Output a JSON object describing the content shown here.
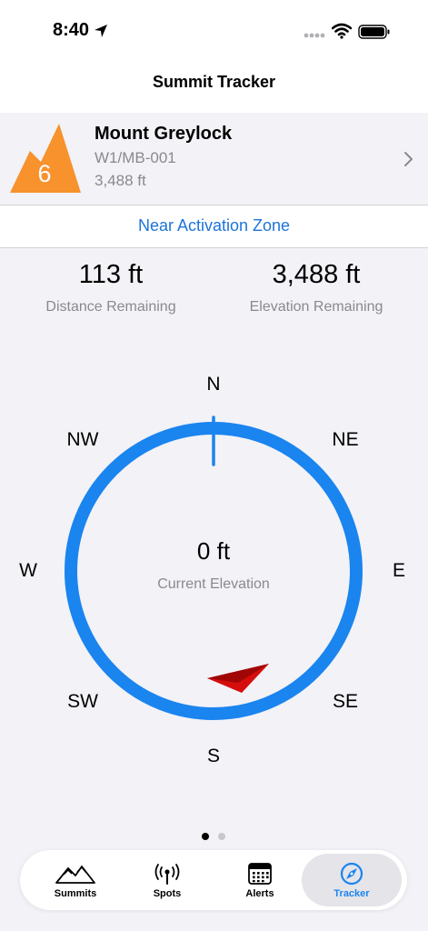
{
  "status_bar": {
    "time": "8:40"
  },
  "nav": {
    "title": "Summit Tracker"
  },
  "summit": {
    "badge_number": "6",
    "name": "Mount Greylock",
    "reference": "W1/MB-001",
    "elevation": "3,488 ft"
  },
  "zone_banner": {
    "text": "Near Activation Zone"
  },
  "stats": {
    "distance_value": "113 ft",
    "distance_label": "Distance Remaining",
    "elevation_value": "3,488 ft",
    "elevation_label": "Elevation Remaining"
  },
  "compass": {
    "n": "N",
    "ne": "NE",
    "e": "E",
    "se": "SE",
    "s": "S",
    "sw": "SW",
    "w": "W",
    "nw": "NW",
    "center_value": "0 ft",
    "center_label": "Current Elevation"
  },
  "tabs": [
    {
      "label": "Summits",
      "icon": "mountains-icon"
    },
    {
      "label": "Spots",
      "icon": "antenna-icon"
    },
    {
      "label": "Alerts",
      "icon": "calendar-icon"
    },
    {
      "label": "Tracker",
      "icon": "compass-icon"
    }
  ],
  "colors": {
    "accent": "#1a84ef",
    "badge_orange": "#f7922d",
    "pointer_red": "#d50d0d",
    "link_blue": "#1d74d8"
  }
}
